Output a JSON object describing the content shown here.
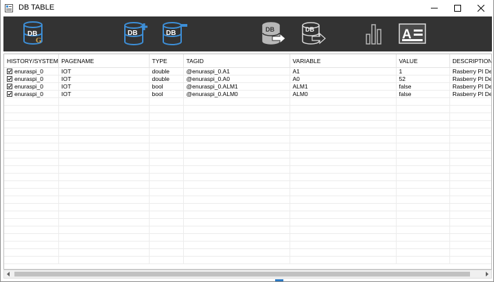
{
  "window": {
    "title": "DB TABLE"
  },
  "toolbar": {
    "buttons": [
      {
        "name": "db-g",
        "label": "DB",
        "sub": "G"
      },
      {
        "name": "db-add",
        "label": "DB"
      },
      {
        "name": "db-edit",
        "label": "DB"
      },
      {
        "name": "db-import",
        "label": "DB"
      },
      {
        "name": "db-export",
        "label": "DB"
      },
      {
        "name": "chart",
        "label": ""
      },
      {
        "name": "font",
        "label": "A"
      }
    ]
  },
  "grid": {
    "columns": [
      "HISTORY/SYSTEM",
      "PAGENAME",
      "TYPE",
      "TAGID",
      "VARIABLE",
      "VALUE",
      "DESCRIPTION"
    ],
    "rows": [
      {
        "checked": true,
        "history": "enuraspi_0",
        "pagename": "IOT",
        "type": "double",
        "tagid": "@enuraspi_0.A1",
        "variable": "A1",
        "value": "1",
        "description": "Rasberry PI De"
      },
      {
        "checked": true,
        "history": "enuraspi_0",
        "pagename": "IOT",
        "type": "double",
        "tagid": "@enuraspi_0.A0",
        "variable": "A0",
        "value": "52",
        "description": "Rasberry PI De"
      },
      {
        "checked": true,
        "history": "enuraspi_0",
        "pagename": "IOT",
        "type": "bool",
        "tagid": "@enuraspi_0.ALM1",
        "variable": "ALM1",
        "value": "false",
        "description": "Rasberry PI De"
      },
      {
        "checked": true,
        "history": "enuraspi_0",
        "pagename": "IOT",
        "type": "bool",
        "tagid": "@enuraspi_0.ALM0",
        "variable": "ALM0",
        "value": "false",
        "description": "Rasberry PI De"
      }
    ],
    "empty_rows": 22
  },
  "colors": {
    "toolbar_bg": "#333333",
    "icon_blue": "#3d8fd8",
    "icon_gray": "#b8b8b8",
    "icon_white": "#ffffff",
    "accent_gold": "#d7a54a"
  }
}
